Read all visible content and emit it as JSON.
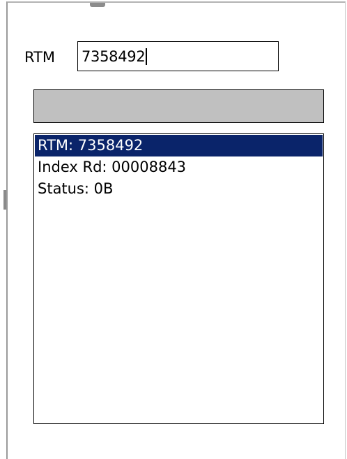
{
  "form": {
    "rtm_label": "RTM",
    "rtm_value": "7358492"
  },
  "progress": {
    "value": 0
  },
  "results": {
    "items": [
      {
        "text": "RTM: 7358492",
        "selected": true
      },
      {
        "text": "Index Rd: 00008843",
        "selected": false
      },
      {
        "text": "Status: 0B",
        "selected": false
      }
    ]
  },
  "colors": {
    "selection_background": "#0a246a",
    "progress_background": "#c0c0c0"
  }
}
